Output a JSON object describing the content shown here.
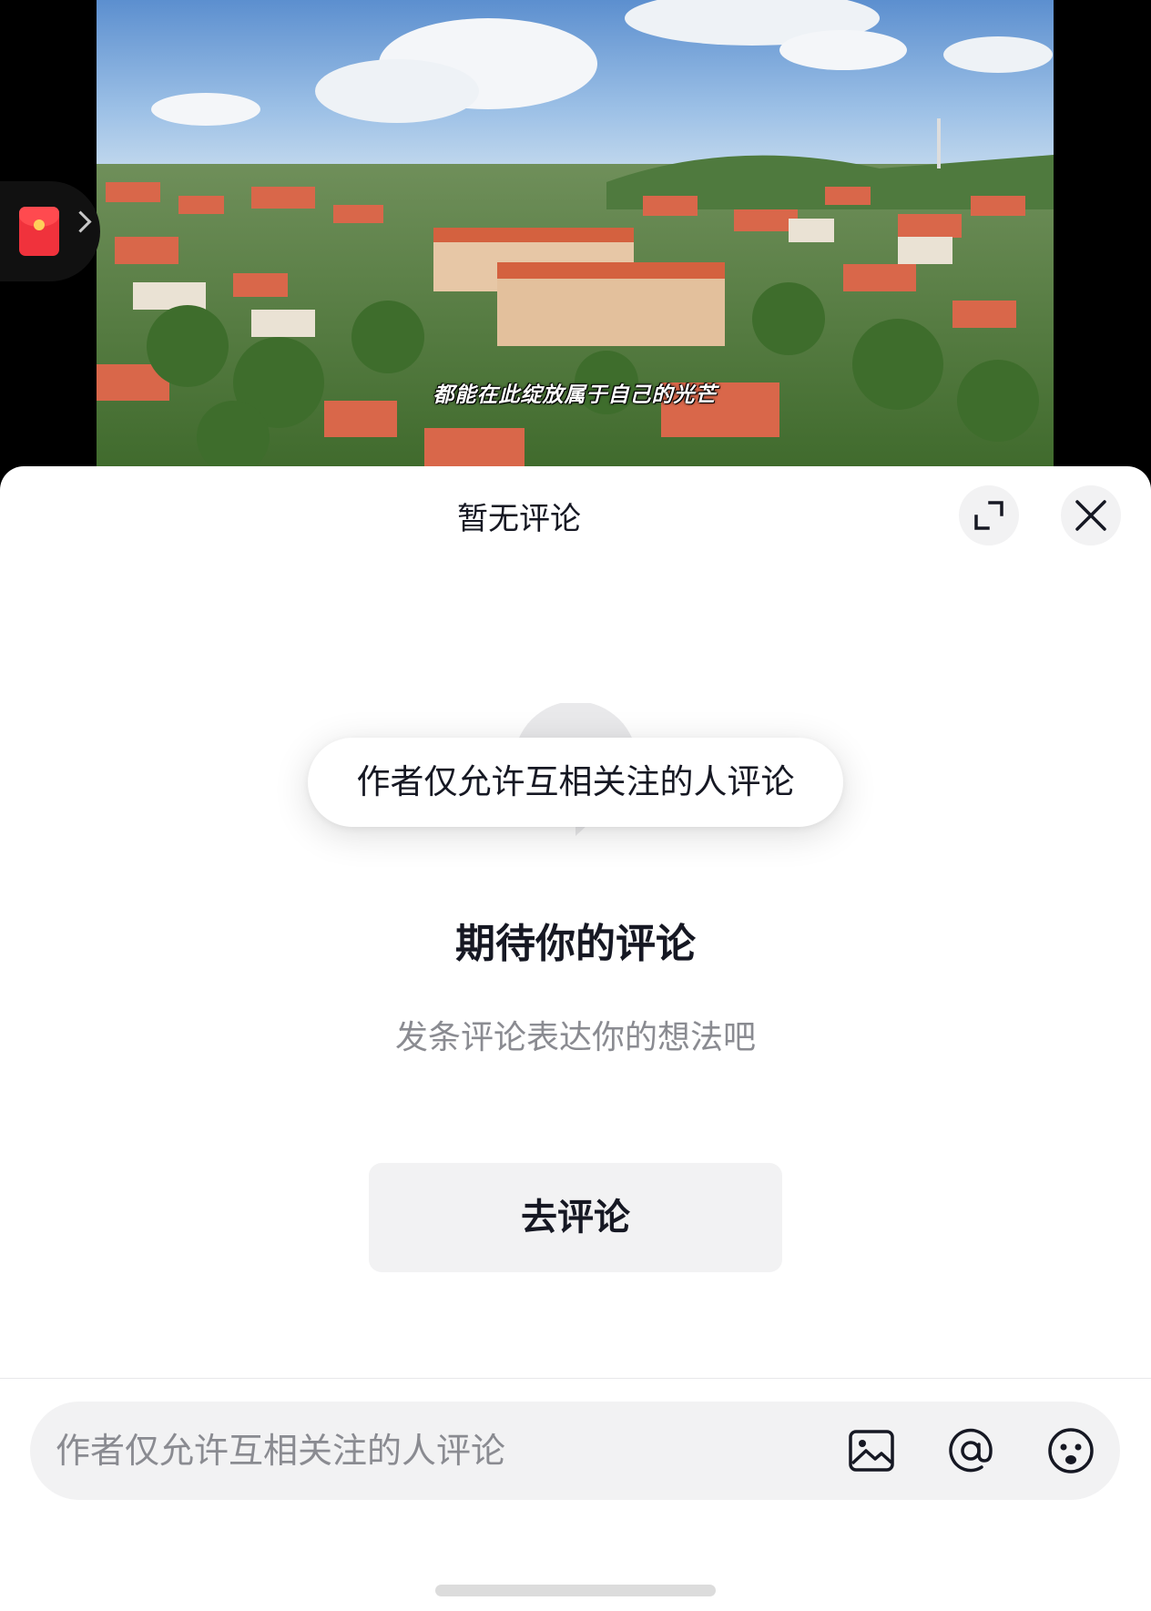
{
  "video": {
    "subtitle": "都能在此绽放属于自己的光芒"
  },
  "side_tab": {
    "icon": "red-packet-icon"
  },
  "sheet": {
    "title": "暂无评论",
    "expand_icon": "expand-icon",
    "close_icon": "close-icon"
  },
  "toast": {
    "text": "作者仅允许互相关注的人评论"
  },
  "empty_state": {
    "title": "期待你的评论",
    "subtitle": "发条评论表达你的想法吧",
    "button_label": "去评论"
  },
  "input_bar": {
    "placeholder": "作者仅允许互相关注的人评论",
    "icons": [
      "image-icon",
      "at-icon",
      "emoji-icon"
    ]
  }
}
